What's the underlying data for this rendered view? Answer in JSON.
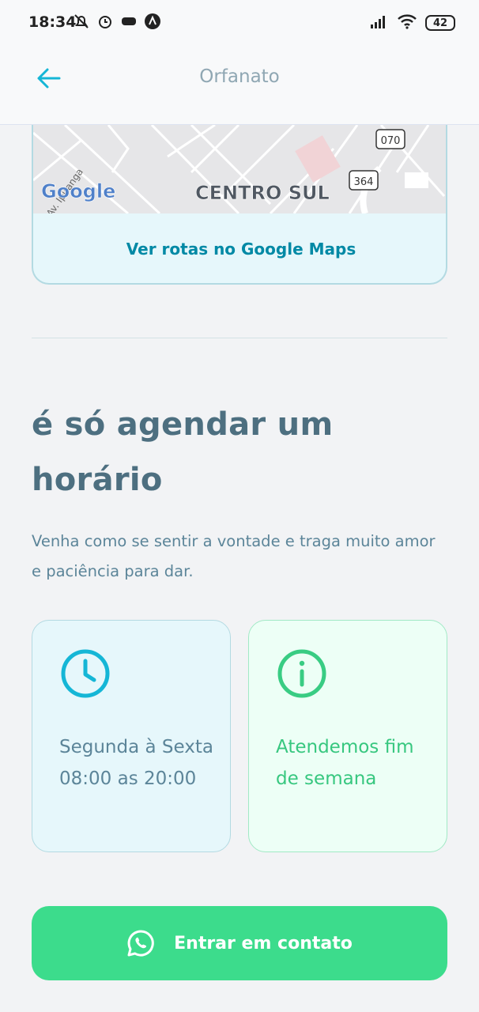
{
  "status_bar": {
    "time": "18:34",
    "battery": "42",
    "icons": [
      "notifications-off-icon",
      "alarm-icon",
      "game-icon",
      "app-icon",
      "signal-icon",
      "wifi-icon",
      "battery-icon"
    ]
  },
  "header": {
    "back_icon": "arrow-left-icon",
    "title": "Orfanato"
  },
  "map": {
    "labels": {
      "street": "Av. Ipiranga",
      "logo": "Google",
      "district": "CENTRO SUL",
      "road_1": "070",
      "road_2": "364"
    },
    "link_label": "Ver rotas no Google Maps"
  },
  "main": {
    "heading": "é só agendar um horário",
    "description": "Venha como se sentir a vontade e traga muito amor e paciência para dar."
  },
  "cards": {
    "hours": {
      "icon": "clock-icon",
      "text": "Segunda à Sexta 08:00 as 20:00"
    },
    "weekend": {
      "icon": "info-icon",
      "text": "Atendemos fim de semana"
    }
  },
  "contact": {
    "icon": "whatsapp-icon",
    "label": "Entrar em contato"
  },
  "colors": {
    "accent_blue": "#15b6d6",
    "accent_green": "#39cc83",
    "button_green": "#3cdc8c",
    "heading_text": "#4d6f80"
  }
}
